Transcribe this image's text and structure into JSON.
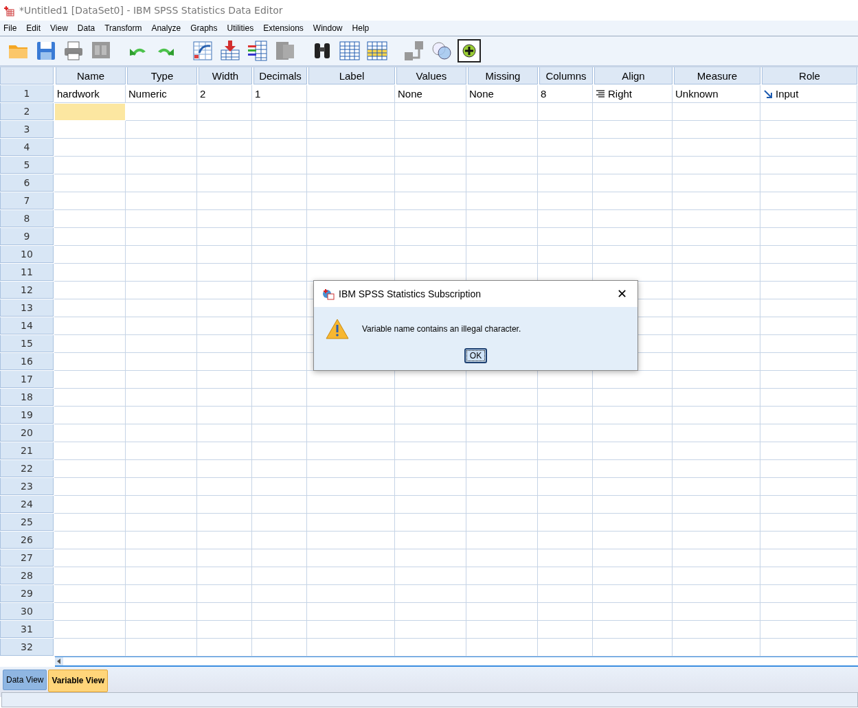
{
  "window": {
    "title": "*Untitled1 [DataSet0] - IBM SPSS Statistics Data Editor"
  },
  "menu": [
    "File",
    "Edit",
    "View",
    "Data",
    "Transform",
    "Analyze",
    "Graphs",
    "Utilities",
    "Extensions",
    "Window",
    "Help"
  ],
  "table": {
    "columns": [
      "Name",
      "Type",
      "Width",
      "Decimals",
      "Label",
      "Values",
      "Missing",
      "Columns",
      "Align",
      "Measure",
      "Role"
    ],
    "rows": [
      {
        "number": "1",
        "name_cell_selected": false,
        "cells": [
          "hardwork",
          "Numeric",
          "2",
          "1",
          "",
          "None",
          "None",
          "8",
          "Right",
          "Unknown",
          "Input"
        ]
      },
      {
        "number": "2",
        "name_cell_selected": true
      },
      {
        "number": "3",
        "name_cell_selected": false
      },
      {
        "number": "4",
        "name_cell_selected": false
      },
      {
        "number": "5",
        "name_cell_selected": false
      },
      {
        "number": "6",
        "name_cell_selected": false
      },
      {
        "number": "7",
        "name_cell_selected": false
      },
      {
        "number": "8",
        "name_cell_selected": false
      },
      {
        "number": "9",
        "name_cell_selected": false
      },
      {
        "number": "10",
        "name_cell_selected": false
      },
      {
        "number": "11",
        "name_cell_selected": false
      },
      {
        "number": "12",
        "name_cell_selected": false
      },
      {
        "number": "13",
        "name_cell_selected": false
      },
      {
        "number": "14",
        "name_cell_selected": false
      },
      {
        "number": "15",
        "name_cell_selected": false
      },
      {
        "number": "16",
        "name_cell_selected": false
      },
      {
        "number": "17",
        "name_cell_selected": false
      },
      {
        "number": "18",
        "name_cell_selected": false
      },
      {
        "number": "19",
        "name_cell_selected": false
      },
      {
        "number": "20",
        "name_cell_selected": false
      },
      {
        "number": "21",
        "name_cell_selected": false
      },
      {
        "number": "22",
        "name_cell_selected": false
      },
      {
        "number": "23",
        "name_cell_selected": false
      },
      {
        "number": "24",
        "name_cell_selected": false
      },
      {
        "number": "25",
        "name_cell_selected": false
      },
      {
        "number": "26",
        "name_cell_selected": false
      },
      {
        "number": "27",
        "name_cell_selected": false
      },
      {
        "number": "28",
        "name_cell_selected": false
      },
      {
        "number": "29",
        "name_cell_selected": false
      },
      {
        "number": "30",
        "name_cell_selected": false
      },
      {
        "number": "31",
        "name_cell_selected": false
      },
      {
        "number": "32",
        "name_cell_selected": false
      }
    ]
  },
  "tabs": [
    {
      "label": "Data View",
      "selected": false
    },
    {
      "label": "Variable View",
      "selected": true
    }
  ],
  "dialog": {
    "title": "IBM SPSS Statistics Subscription",
    "close": "✕",
    "message": "Variable name contains an illegal character.",
    "button": "OK"
  }
}
